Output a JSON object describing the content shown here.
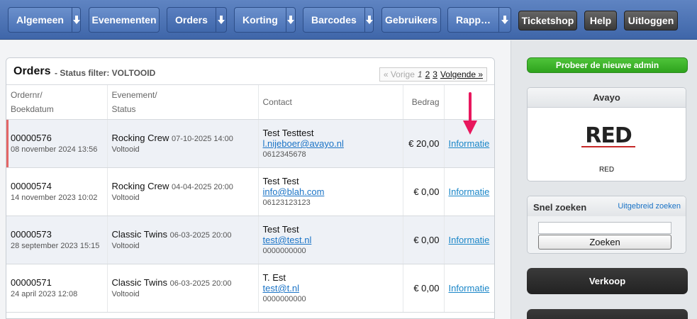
{
  "nav": {
    "items": [
      {
        "label": "Algemeen",
        "has_arrow": true
      },
      {
        "label": "Evenementen",
        "has_arrow": false
      },
      {
        "label": "Orders",
        "has_arrow": true
      },
      {
        "label": "Korting",
        "has_arrow": true
      },
      {
        "label": "Barcodes",
        "has_arrow": true
      },
      {
        "label": "Gebruikers",
        "has_arrow": false
      },
      {
        "label": "Rapp…",
        "has_arrow": true
      }
    ],
    "ticketshop": "Ticketshop",
    "help": "Help",
    "logout": "Uitloggen"
  },
  "panel": {
    "title": "Orders",
    "filter": "- Status filter: VOLTOOID",
    "pager": {
      "prev": "« Vorige",
      "current": "1",
      "page2": "2",
      "page3": "3",
      "next": "Volgende »"
    }
  },
  "table": {
    "headers": {
      "col1a": "Ordernr/",
      "col1b": "Boekdatum",
      "col2a": "Evenement/",
      "col2b": "Status",
      "col3": "Contact",
      "col4": "Bedrag"
    },
    "rows": [
      {
        "ordernr": "00000576",
        "date": "08 november 2024 13:56",
        "event": "Rocking Crew",
        "event_date": "07-10-2025 14:00",
        "status": "Voltooid",
        "name": "Test Testtest",
        "email": "l.nijeboer@avayo.nl",
        "phone": "0612345678",
        "amount": "€ 20,00",
        "link": "Informatie"
      },
      {
        "ordernr": "00000574",
        "date": "14 november 2023 10:02",
        "event": "Rocking Crew",
        "event_date": "04-04-2025 20:00",
        "status": "Voltooid",
        "name": "Test Test",
        "email": "info@blah.com",
        "phone": "06123123123",
        "amount": "€ 0,00",
        "link": "Informatie"
      },
      {
        "ordernr": "00000573",
        "date": "28 september 2023 15:15",
        "event": "Classic Twins",
        "event_date": "06-03-2025 20:00",
        "status": "Voltooid",
        "name": "Test Test",
        "email": "test@test.nl",
        "phone": "0000000000",
        "amount": "€ 0,00",
        "link": "Informatie"
      },
      {
        "ordernr": "00000571",
        "date": "24 april 2023 12:08",
        "event": "Classic Twins",
        "event_date": "06-03-2025 20:00",
        "status": "Voltooid",
        "name": "T. Est",
        "email": "test@t.nl",
        "phone": "0000000000",
        "amount": "€ 0,00",
        "link": "Informatie"
      }
    ]
  },
  "sidebar": {
    "new_admin": "Probeer de nieuwe admin",
    "org_title": "Avayo",
    "logo_text": "RED",
    "logo_caption": "RED",
    "search_title": "Snel zoeken",
    "search_link": "Uitgebreid zoeken",
    "search_button": "Zoeken",
    "verkoop": "Verkoop"
  },
  "colors": {
    "nav": "#4a72b6",
    "accent_green": "#2ea31d",
    "link": "#1a86c8",
    "annotation": "#e8175d"
  }
}
